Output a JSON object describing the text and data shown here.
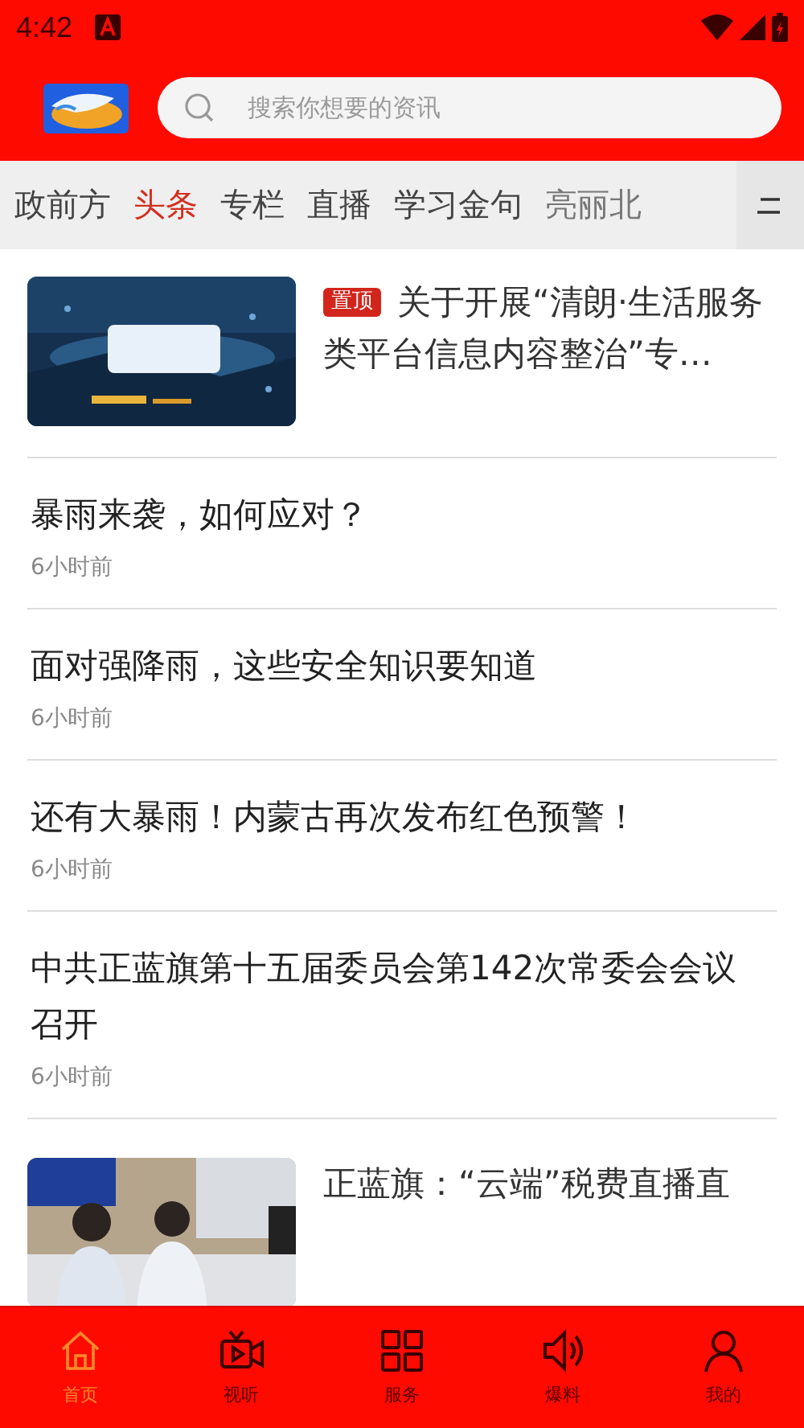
{
  "status_bar": {
    "time": "4:42"
  },
  "search": {
    "placeholder": "搜索你想要的资讯"
  },
  "tabs": [
    {
      "label": "政前方",
      "selected": false
    },
    {
      "label": "头条",
      "selected": true
    },
    {
      "label": "专栏",
      "selected": false
    },
    {
      "label": "直播",
      "selected": false
    },
    {
      "label": "学习金句",
      "selected": false
    },
    {
      "label": "亮丽北",
      "selected": false
    }
  ],
  "articles": [
    {
      "kind": "featured",
      "badge": "置顶",
      "title": "关于开展“清朗·生活服务类平台信息内容整治”专…"
    },
    {
      "kind": "text",
      "title": "暴雨来袭，如何应对？",
      "time": "6小时前"
    },
    {
      "kind": "text",
      "title": "面对强降雨，这些安全知识要知道",
      "time": "6小时前"
    },
    {
      "kind": "text",
      "title": "还有大暴雨！内蒙古再次发布红色预警！",
      "time": "6小时前"
    },
    {
      "kind": "text",
      "title": "中共正蓝旗第十五届委员会第142次常委会会议召开",
      "time": "6小时前"
    },
    {
      "kind": "thumb",
      "title": "正蓝旗：“云端”税费直播直"
    }
  ],
  "nav": [
    {
      "label": "首页",
      "kind": "home",
      "selected": true
    },
    {
      "label": "视听",
      "kind": "video",
      "selected": false
    },
    {
      "label": "服务",
      "kind": "grid",
      "selected": false
    },
    {
      "label": "爆料",
      "kind": "speaker",
      "selected": false
    },
    {
      "label": "我的",
      "kind": "user",
      "selected": false
    }
  ]
}
